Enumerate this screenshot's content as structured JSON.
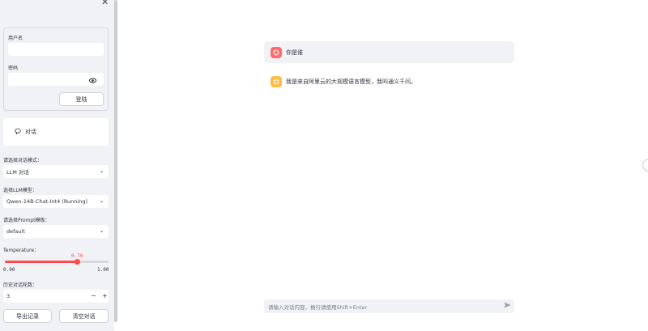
{
  "sidebar": {
    "close_icon": "close-icon",
    "login": {
      "username_label": "用户名",
      "username_value": "",
      "password_label": "密码",
      "password_value": "",
      "eye_icon": "eye-icon",
      "login_button": "登陆"
    },
    "menu": {
      "icon": "chat-bubble-icon",
      "label": "对话"
    },
    "dialog_mode": {
      "label": "请选择对话模式：",
      "value": "LLM 对话"
    },
    "llm_model": {
      "label": "选择LLM模型：",
      "value": "Qwen-14B-Chat-Int4 (Running)"
    },
    "prompt_template": {
      "label": "请选择Prompt模板：",
      "value": "default"
    },
    "temperature": {
      "label": "Temperature：",
      "value": "0.70",
      "min": "0.00",
      "max": "1.00",
      "fraction": 0.7
    },
    "history": {
      "label": "历史对话轮数：",
      "value": "3",
      "minus": "−",
      "plus": "+"
    },
    "export_button": "导出记录",
    "clear_button": "清空对话"
  },
  "chat": {
    "messages": [
      {
        "role": "user",
        "text": "你是谁",
        "avatar_icon": "user-avatar-icon",
        "avatar_color": "#ff6b6b",
        "bg": "#f0f2f6"
      },
      {
        "role": "assistant",
        "text": "我是来自阿里云的大规模语言模型，我叫通义千问。",
        "avatar_icon": "assistant-avatar-icon",
        "avatar_color": "#ffbd45",
        "bg": "#ffffff"
      }
    ],
    "input_placeholder": "请输入对话内容，换行请使用Shift+Enter",
    "send_icon": "send-icon"
  },
  "colors": {
    "accent": "#ff4b4b",
    "sidebar_bg": "#f0f2f6"
  }
}
